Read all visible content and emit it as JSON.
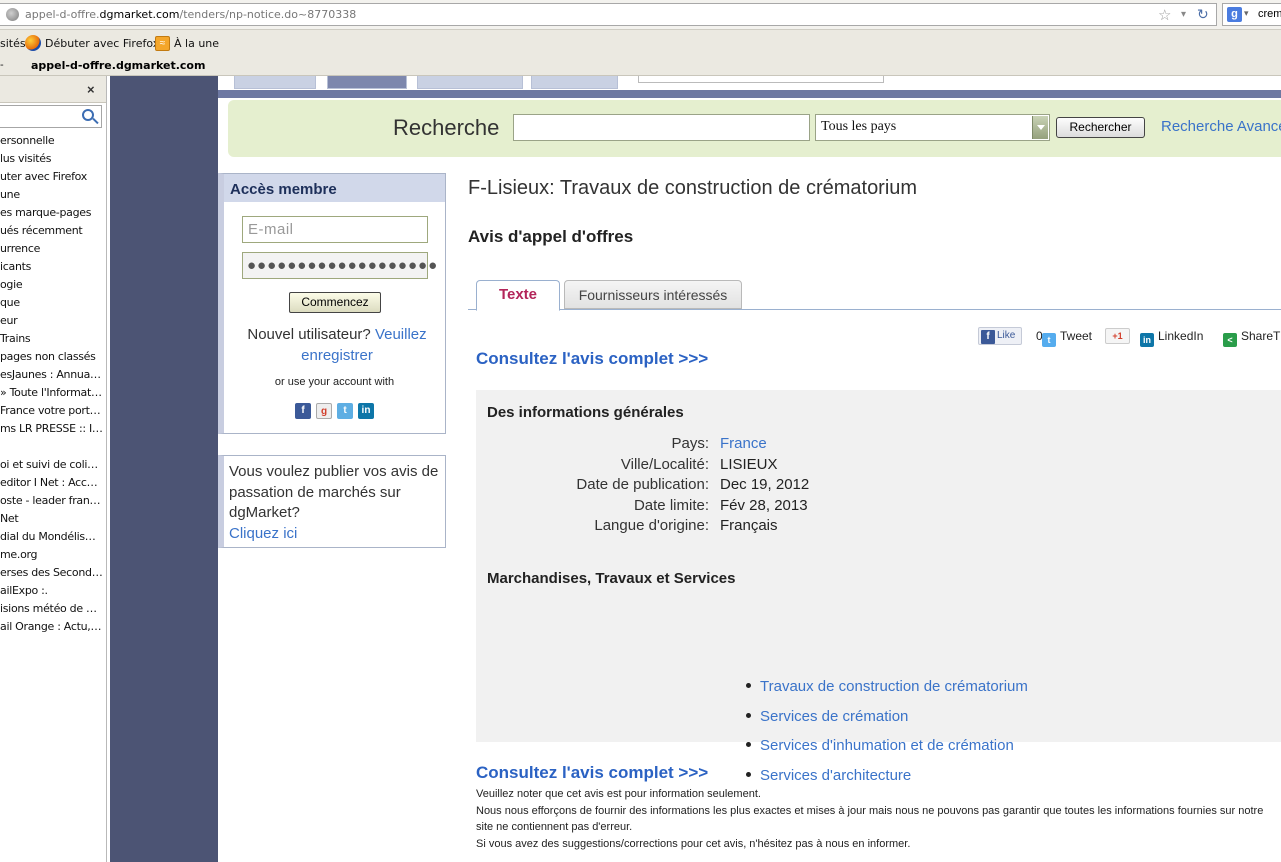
{
  "browser": {
    "url_prefix": "appel-d-offre.",
    "url_domain": "dgmarket.com",
    "url_path": "/tenders/np-notice.do~8770338",
    "search_text": "crem",
    "tab_dash": "-",
    "tab_title": "appel-d-offre.dgmarket.com"
  },
  "bookmarks_bar": {
    "items": [
      {
        "label": "sités"
      },
      {
        "label": "Débuter avec Firefox"
      },
      {
        "label": "À la une"
      }
    ]
  },
  "sidebar": {
    "close_label": "×",
    "items": [
      "ersonnelle",
      "lus visités",
      "uter avec Firefox",
      "une",
      "es marque-pages",
      "ués récemment",
      "urrence",
      "icants",
      "ogie",
      "que",
      "eur",
      "Trains",
      "pages non classés",
      "esJaunes : Annuair...",
      "» Toute l'Informatio...",
      "France votre portai...",
      "ms LR PRESSE :: In...",
      "",
      "oi et suivi de colis e...",
      "editor I Net : Accueil",
      "oste - leader franç...",
      "Net",
      "dial du Mondélisme ...",
      "me.org",
      "erses des Secondai...",
      "ailExpo :.",
      "isions météo de Mé...",
      "ail Orange : Actu, S..."
    ]
  },
  "search": {
    "label": "Recherche",
    "input_value": "",
    "country_selected": "Tous les pays",
    "button_label": "Rechercher",
    "advanced_link": "Recherche Avancée"
  },
  "member": {
    "title": "Accès membre",
    "email_placeholder": "E-mail",
    "password_mask": "●●●●●●●●●●●●●●●●●●●",
    "login_button": "Commencez",
    "new_user_text": "Nouvel utilisateur?",
    "register_link": "Veuillez enregistrer",
    "social_text": "or use your account with",
    "social_icons": [
      "facebook-icon",
      "google-icon",
      "twitter-icon",
      "linkedin-icon"
    ]
  },
  "publish": {
    "text": "Vous voulez publier vos avis de passation de marchés sur dgMarket?",
    "link": "Cliquez ici"
  },
  "notice": {
    "title": "F-Lisieux: Travaux de construction de crématorium",
    "subtitle": "Avis d'appel d'offres",
    "tabs": [
      {
        "label": "Texte",
        "active": true
      },
      {
        "label": "Fournisseurs intéressés",
        "active": false
      }
    ],
    "share": {
      "fb_like": "Like",
      "fb_count": "0",
      "tweet": "Tweet",
      "gplus": "+1",
      "linkedin": "LinkedIn",
      "sharethis": "ShareThis"
    },
    "consult_link": "Consultez l'avis complet >>>",
    "general_title": "Des informations générales",
    "general": [
      {
        "label": "Pays:",
        "value": "France",
        "link": true
      },
      {
        "label": "Ville/Localité:",
        "value": "LISIEUX",
        "link": false
      },
      {
        "label": "Date de publication:",
        "value": "Dec 19, 2012",
        "link": false
      },
      {
        "label": "Date limite:",
        "value": "Fév 28, 2013",
        "link": false
      },
      {
        "label": "Langue d'origine:",
        "value": "Français",
        "link": false
      }
    ],
    "goods_title": "Marchandises, Travaux et Services",
    "goods": [
      "Travaux de construction de crématorium",
      "Services de crémation",
      "Services d'inhumation et de crémation",
      "Services d'architecture"
    ],
    "disclaimer": [
      "Veuillez noter que cet avis est pour information seulement.",
      "Nous nous efforçons de fournir des informations les plus exactes et mises à jour mais nous ne pouvons pas garantir que toutes les informations fournies sur notre site ne contiennent pas d'erreur.",
      "Si vous avez des suggestions/corrections pour cet avis, n'hésitez pas à nous en informer."
    ]
  },
  "colors": {
    "nav_dark": "#4c5474",
    "search_band": "#e5efcf",
    "link_blue": "#3a73c9",
    "active_tab": "#b3255a"
  }
}
